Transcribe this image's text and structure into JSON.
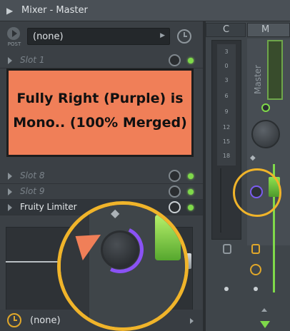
{
  "window": {
    "title": "Mixer - Master"
  },
  "left_panel": {
    "post_label": "POST",
    "preset": {
      "value": "(none)"
    },
    "slots": [
      {
        "label": "Slot 1",
        "active": false
      },
      {
        "label": "Slot 8",
        "active": false
      },
      {
        "label": "Slot 9",
        "active": false
      },
      {
        "label": "Fruity Limiter",
        "active": true
      }
    ],
    "bottom": {
      "value": "(none)"
    }
  },
  "mixer": {
    "headers": {
      "c": "C",
      "m": "M"
    },
    "meter_ticks": [
      "3",
      "0",
      "3",
      "6",
      "9",
      "12",
      "15",
      "18"
    ],
    "master_label": "Master"
  },
  "annotation": {
    "line1": "Fully Right (Purple) is",
    "line2": "Mono.. (100% Merged)"
  },
  "colors": {
    "callout": "#f07f58",
    "highlight": "#f0b42a",
    "pan_purple": "#8a52f5",
    "led_green": "#7fd94a"
  },
  "icons": {
    "window_arrow": "arrow-right-icon",
    "post": "post-arrow-icon",
    "clock": "clock-icon",
    "lock": "lock-icon",
    "stereo": "stereo-separation-icon"
  }
}
